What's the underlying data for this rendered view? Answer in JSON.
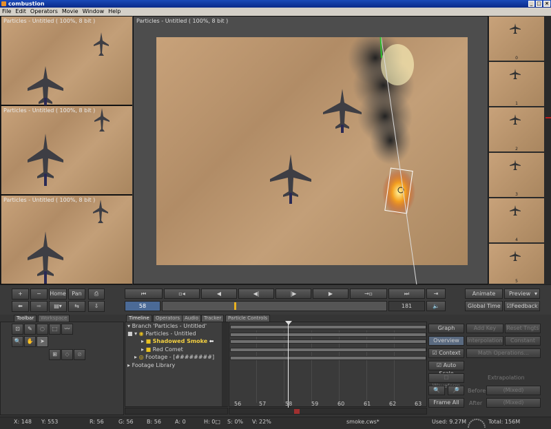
{
  "window": {
    "title": "combustion"
  },
  "menu": [
    "File",
    "Edit",
    "Operators",
    "Movie",
    "Window",
    "Help"
  ],
  "viewports": {
    "small_top": "Particles - Untitled ( 100%, 8 bit )",
    "small_mid": "Particles - Untitled ( 100%, 8 bit )",
    "small_bot": "Particles - Untitled ( 100%, 8 bit )",
    "main": "Particles - Untitled ( 100%, 8 bit )"
  },
  "thumbnails": [
    "0",
    "1",
    "2",
    "3",
    "4",
    "5"
  ],
  "left_tools": {
    "plus": "+",
    "minus": "−",
    "home": "Home",
    "pan": "Pan"
  },
  "transport": {
    "current_frame": "58",
    "end_frame": "181"
  },
  "right_tools": {
    "animate": "Animate",
    "preview": "Preview",
    "global_time": "Global Time",
    "feedback": "Feedback"
  },
  "left_tabs": [
    "Toolbar",
    "Workspace"
  ],
  "timeline_tabs": [
    "Timeline",
    "Operators",
    "Audio",
    "Tracker",
    "Particle Controls"
  ],
  "tree": {
    "branch": "Branch 'Particles - Untitled'",
    "particles": "Particles - Untitled",
    "shadowed": "Shadowed Smoke",
    "comet": "Red Comet",
    "footage": "Footage - [########]",
    "library": "Footage Library"
  },
  "ticks": [
    "56",
    "57",
    "58",
    "59",
    "60",
    "61",
    "62",
    "63"
  ],
  "right_panel": {
    "graph": "Graph",
    "add_key": "Add Key",
    "reset_tngts": "Reset Tngts",
    "overview": "Overview",
    "interpolation": "Interpolation",
    "constant": "Constant",
    "context": "Context",
    "math": "Math Operations...",
    "auto_scale": "Auto Scale",
    "waveform": "Waveform",
    "extrapolation": "Extrapolation",
    "before": "Before",
    "mixed1": "(Mixed)",
    "frame_all": "Frame All",
    "after": "After",
    "mixed2": "(Mixed)"
  },
  "status": {
    "x": "X:   148",
    "y": "Y:  553",
    "r": "R: 56",
    "g": "G: 56",
    "b": "B: 56",
    "a": "A:  0",
    "h": "H: 0□",
    "s": "S:  0%",
    "v": "V:  22%",
    "file": "smoke.cws*",
    "used": "Used: 9.27M",
    "total": "Total: 156M"
  }
}
